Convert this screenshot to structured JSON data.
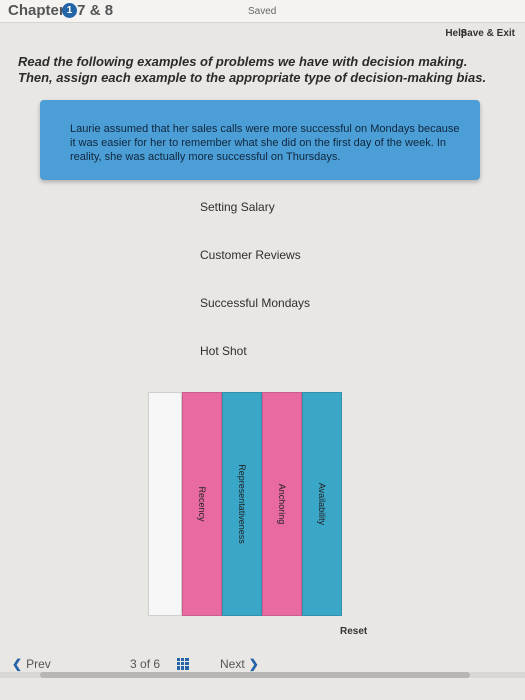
{
  "header": {
    "chapter_title": "Chapters 7 & 8",
    "chapter_badge": "1",
    "status": "Saved",
    "help_label": "Help",
    "save_exit_label": "Save & Exit"
  },
  "question": {
    "instructions": "Read the following examples of problems we have with decision making. Then, assign each example to the appropriate type of decision-making bias.",
    "scenario": "Laurie assumed that her sales calls were more successful on Mondays because it was easier for her to remember what she did on the first day of the week. In reality, she was actually more successful on Thursdays.",
    "examples": [
      "Setting Salary",
      "Customer Reviews",
      "Successful Mondays",
      "Hot Shot"
    ],
    "bias_options": [
      {
        "label": "Availability",
        "color": "#3aa6c8"
      },
      {
        "label": "Anchoring",
        "color": "#e86aa0"
      },
      {
        "label": "Representativeness",
        "color": "#3aa6c8"
      },
      {
        "label": "Recency",
        "color": "#e86aa0"
      }
    ],
    "reset_label": "Reset"
  },
  "navigation": {
    "prev_label": "Prev",
    "page_current": "3",
    "page_of": "of",
    "page_total": "6",
    "next_label": "Next"
  }
}
